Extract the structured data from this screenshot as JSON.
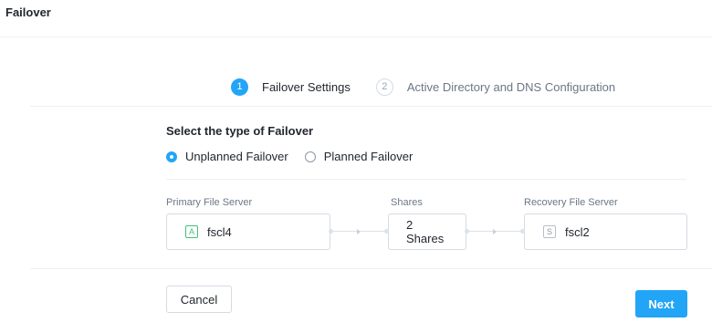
{
  "header": {
    "title": "Failover"
  },
  "stepper": {
    "steps": [
      {
        "number": "1",
        "label": "Failover Settings",
        "active": true
      },
      {
        "number": "2",
        "label": "Active Directory and DNS Configuration",
        "active": false
      }
    ]
  },
  "failover_type": {
    "title": "Select the type of Failover",
    "options": [
      {
        "label": "Unplanned Failover",
        "selected": true
      },
      {
        "label": "Planned Failover",
        "selected": false
      }
    ]
  },
  "mapping": {
    "primary": {
      "label": "Primary File Server",
      "badge": "A",
      "value": "fscl4"
    },
    "shares": {
      "label": "Shares",
      "count": "2",
      "unit": "Shares"
    },
    "recovery": {
      "label": "Recovery File Server",
      "badge": "S",
      "value": "fscl2"
    }
  },
  "footer": {
    "cancel_label": "Cancel",
    "next_label": "Next"
  },
  "colors": {
    "accent": "#22a5f7",
    "badge_active": "#3fc37c"
  }
}
